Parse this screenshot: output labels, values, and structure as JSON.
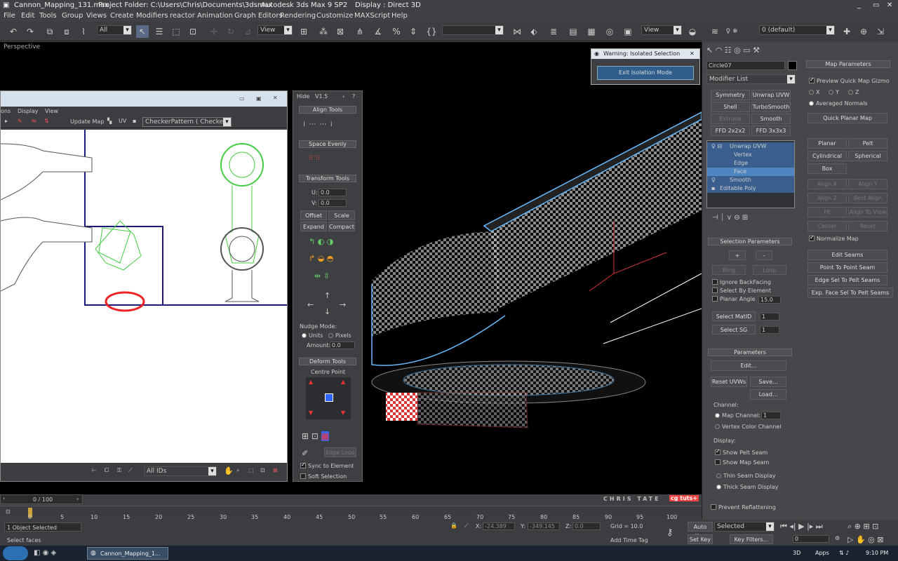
{
  "titlebar": {
    "file": "Cannon_Mapping_131.max",
    "project": "Project Folder: C:\\Users\\Chris\\Documents\\3dsmax",
    "app": "Autodesk 3ds Max 9 SP2",
    "display": "Display : Direct 3D"
  },
  "menu": [
    "File",
    "Edit",
    "Tools",
    "Group",
    "Views",
    "Create",
    "Modifiers",
    "reactor",
    "Animation",
    "Graph Editors",
    "Rendering",
    "Customize",
    "MAXScript",
    "Help"
  ],
  "toolbar": {
    "selection_filter": "All",
    "ref_coord": "View",
    "named_sel": "",
    "ref_coord2": "View",
    "layer": "0 (default)"
  },
  "viewport": {
    "label": "Perspective"
  },
  "uv_editor": {
    "menu": [
      "ons",
      "Display",
      "View"
    ],
    "update_map": "Update Map",
    "pattern": "CheckerPattern  ( Checker )",
    "ids": "All IDs"
  },
  "tools_panel": {
    "hide": "Hide",
    "version": "V1.5",
    "align_tools": "Align Tools",
    "space_evenly": "Space Evenly",
    "transform_tools": "Transform Tools",
    "u_label": "U:",
    "u_value": "0.0",
    "v_label": "V:",
    "v_value": "0.0",
    "offset": "Offset",
    "scale": "Scale",
    "expand": "Expand",
    "compact": "Compact",
    "nudge_mode": "Nudge Mode:",
    "units": "Units",
    "pixels": "Pixels",
    "amount_label": "Amount:",
    "amount_value": "0.0",
    "deform_tools": "Deform Tools",
    "centre_point": "Centre Point",
    "edge_loop": "Edge Loop",
    "sync": "Sync to Element",
    "soft": "Soft Selection"
  },
  "warning": {
    "title": "Warning: Isolated Selection",
    "button": "Exit Isolation Mode"
  },
  "command_panel": {
    "object_name": "Circle07",
    "modifier_list": "Modifier List",
    "mod_buttons": [
      "Symmetry",
      "Unwrap UVW",
      "Shell",
      "TurboSmooth",
      "Extrude",
      "Smooth",
      "FFD 2x2x2",
      "FFD 3x3x3"
    ],
    "stack": [
      "Unwrap UVW",
      "Vertex",
      "Edge",
      "Face",
      "Smooth",
      "Editable Poly"
    ],
    "selection_parameters": "Selection Parameters",
    "plus": "+",
    "minus": "-",
    "ring": "Ring",
    "loop": "Loop",
    "ignore_backfacing": "Ignore BackFacing",
    "select_by_element": "Select By Element",
    "planar_angle": "Planar Angle",
    "planar_value": "15.0",
    "select_matid": "Select MatID",
    "select_sg": "Select SG",
    "matid_value": "1",
    "sg_value": "1",
    "parameters": "Parameters",
    "edit": "Edit...",
    "reset_uvws": "Reset UVWs",
    "save": "Save...",
    "load": "Load...",
    "channel": "Channel:",
    "map_channel": "Map Channel:",
    "map_channel_value": "1",
    "vertex_color_channel": "Vertex Color Channel",
    "display": "Display:",
    "show_pelt_seam": "Show Pelt Seam",
    "show_map_seam": "Show Map Seam",
    "thin_seam": "Thin Seam Display",
    "thick_seam": "Thick Seam Display",
    "prevent_reflattening": "Prevent Reflattening"
  },
  "map_panel": {
    "title": "Map Parameters",
    "preview": "Preview Quick Map Gizmo",
    "x": "X",
    "y": "Y",
    "z": "Z",
    "averaged_normals": "Averaged Normals",
    "quick_planar": "Quick Planar Map",
    "planar": "Planar",
    "pelt": "Pelt",
    "cylindrical": "Cylindrical",
    "spherical": "Spherical",
    "box": "Box",
    "align_x": "Align X",
    "align_y": "Align Y",
    "align_z": "Align Z",
    "best_align": "Best Align",
    "fit": "Fit",
    "align_to_view": "Align To View",
    "center": "Center",
    "reset": "Reset",
    "normalize_map": "Normalize Map",
    "edit_seams": "Edit Seams",
    "point_to_point": "Point To Point Seam",
    "edge_sel": "Edge Sel To Pelt Seams",
    "exp_face": "Exp. Face Sel To Pelt Seams"
  },
  "timeline": {
    "frame": "0 / 100",
    "ticks": [
      "0",
      "5",
      "10",
      "15",
      "20",
      "25",
      "30",
      "35",
      "40",
      "45",
      "50",
      "55",
      "60",
      "65",
      "70",
      "75",
      "80",
      "85",
      "90",
      "95",
      "100"
    ],
    "watermark": "CHRIS TATE",
    "logo": "cg tuts+"
  },
  "status": {
    "selected": "1 Object Selected",
    "prompt": "Select faces",
    "x_label": "X:",
    "x_value": "-24.389",
    "y_label": "Y:",
    "y_value": "-349.145",
    "z_label": "Z:",
    "z_value": "0.0",
    "grid": "Grid = 10.0",
    "add_time_tag": "Add Time Tag",
    "auto_key": "Auto Key",
    "set_key": "Set Key",
    "key_mode": "Selected",
    "key_filters": "Key Filters...",
    "frame_value": "0"
  },
  "taskbar": {
    "task": "Cannon_Mapping_1...",
    "apps": "Apps",
    "mode": "3D",
    "time": "9:10 PM"
  }
}
